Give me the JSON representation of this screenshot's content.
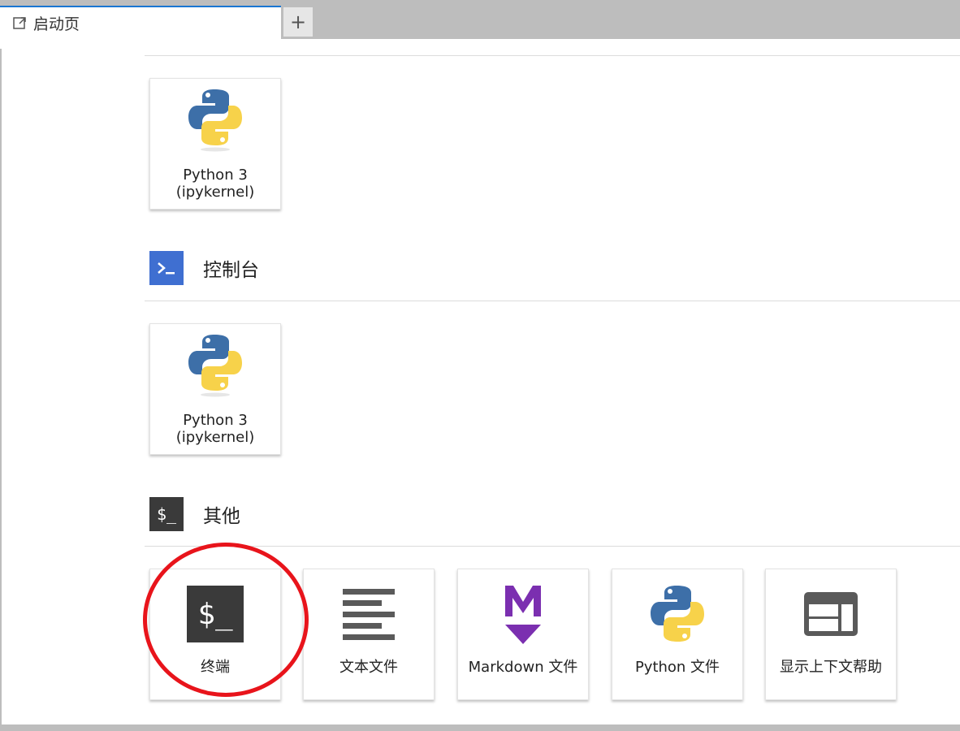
{
  "tabs": [
    {
      "label": "启动页",
      "icon": "launcher-icon"
    }
  ],
  "add_tab_label": "+",
  "sections": {
    "notebook": {
      "cards": [
        {
          "label_line1": "Python 3",
          "label_line2": "(ipykernel)",
          "icon": "python-logo-icon"
        }
      ]
    },
    "console": {
      "title": "控制台",
      "icon": "console-icon",
      "icon_color": "#3f6fd1",
      "cards": [
        {
          "label_line1": "Python 3",
          "label_line2": "(ipykernel)",
          "icon": "python-logo-icon"
        }
      ]
    },
    "other": {
      "title": "其他",
      "icon": "terminal-icon",
      "icon_color": "#3a3a3a",
      "cards": [
        {
          "label": "终端",
          "icon": "terminal-icon"
        },
        {
          "label": "文本文件",
          "icon": "text-file-icon"
        },
        {
          "label": "Markdown 文件",
          "icon": "markdown-icon"
        },
        {
          "label": "Python 文件",
          "icon": "python-logo-icon"
        },
        {
          "label": "显示上下文帮助",
          "icon": "context-help-icon"
        }
      ]
    }
  },
  "colors": {
    "markdown_purple": "#7b2fb0",
    "python_blue": "#3d6fa8",
    "python_yellow": "#f7d24a",
    "highlight_red": "#e8141b"
  }
}
